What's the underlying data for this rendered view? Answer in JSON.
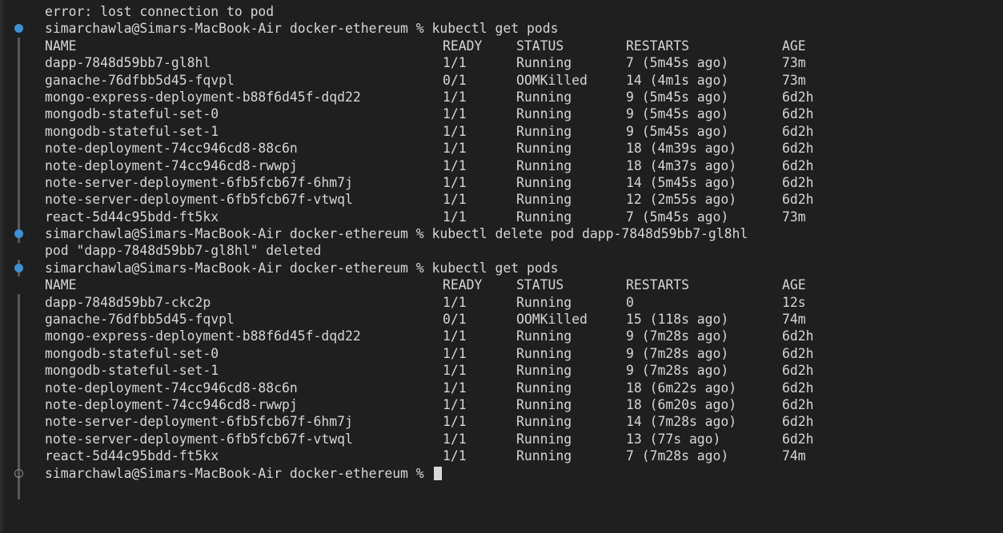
{
  "terminal": {
    "error_line": "error: lost connection to pod",
    "prompt": "simarchawla@Simars-MacBook-Air docker-ethereum %",
    "commands": {
      "get_pods": "kubectl get pods",
      "delete_pod": "kubectl delete pod dapp-7848d59bb7-gl8hl"
    },
    "delete_output": "pod \"dapp-7848d59bb7-gl8hl\" deleted",
    "columns": [
      "NAME",
      "READY",
      "STATUS",
      "RESTARTS",
      "AGE"
    ],
    "table1": [
      [
        "dapp-7848d59bb7-gl8hl",
        "1/1",
        "Running",
        "7 (5m45s ago)",
        "73m"
      ],
      [
        "ganache-76dfbb5d45-fqvpl",
        "0/1",
        "OOMKilled",
        "14 (4m1s ago)",
        "73m"
      ],
      [
        "mongo-express-deployment-b88f6d45f-dqd22",
        "1/1",
        "Running",
        "9 (5m45s ago)",
        "6d2h"
      ],
      [
        "mongodb-stateful-set-0",
        "1/1",
        "Running",
        "9 (5m45s ago)",
        "6d2h"
      ],
      [
        "mongodb-stateful-set-1",
        "1/1",
        "Running",
        "9 (5m45s ago)",
        "6d2h"
      ],
      [
        "note-deployment-74cc946cd8-88c6n",
        "1/1",
        "Running",
        "18 (4m39s ago)",
        "6d2h"
      ],
      [
        "note-deployment-74cc946cd8-rwwpj",
        "1/1",
        "Running",
        "18 (4m37s ago)",
        "6d2h"
      ],
      [
        "note-server-deployment-6fb5fcb67f-6hm7j",
        "1/1",
        "Running",
        "14 (5m45s ago)",
        "6d2h"
      ],
      [
        "note-server-deployment-6fb5fcb67f-vtwql",
        "1/1",
        "Running",
        "12 (2m55s ago)",
        "6d2h"
      ],
      [
        "react-5d44c95bdd-ft5kx",
        "1/1",
        "Running",
        "7 (5m45s ago)",
        "73m"
      ]
    ],
    "table2": [
      [
        "dapp-7848d59bb7-ckc2p",
        "1/1",
        "Running",
        "0",
        "12s"
      ],
      [
        "ganache-76dfbb5d45-fqvpl",
        "0/1",
        "OOMKilled",
        "15 (118s ago)",
        "74m"
      ],
      [
        "mongo-express-deployment-b88f6d45f-dqd22",
        "1/1",
        "Running",
        "9 (7m28s ago)",
        "6d2h"
      ],
      [
        "mongodb-stateful-set-0",
        "1/1",
        "Running",
        "9 (7m28s ago)",
        "6d2h"
      ],
      [
        "mongodb-stateful-set-1",
        "1/1",
        "Running",
        "9 (7m28s ago)",
        "6d2h"
      ],
      [
        "note-deployment-74cc946cd8-88c6n",
        "1/1",
        "Running",
        "18 (6m22s ago)",
        "6d2h"
      ],
      [
        "note-deployment-74cc946cd8-rwwpj",
        "1/1",
        "Running",
        "18 (6m20s ago)",
        "6d2h"
      ],
      [
        "note-server-deployment-6fb5fcb67f-6hm7j",
        "1/1",
        "Running",
        "14 (7m28s ago)",
        "6d2h"
      ],
      [
        "note-server-deployment-6fb5fcb67f-vtwql",
        "1/1",
        "Running",
        "13 (77s ago)",
        "6d2h"
      ],
      [
        "react-5d44c95bdd-ft5kx",
        "1/1",
        "Running",
        "7 (7m28s ago)",
        "74m"
      ]
    ],
    "colors": {
      "background": "#1f1f1f",
      "text": "#d6d6d6",
      "success_marker": "#3d8fd6",
      "cursor": "#d9d9d9"
    }
  }
}
